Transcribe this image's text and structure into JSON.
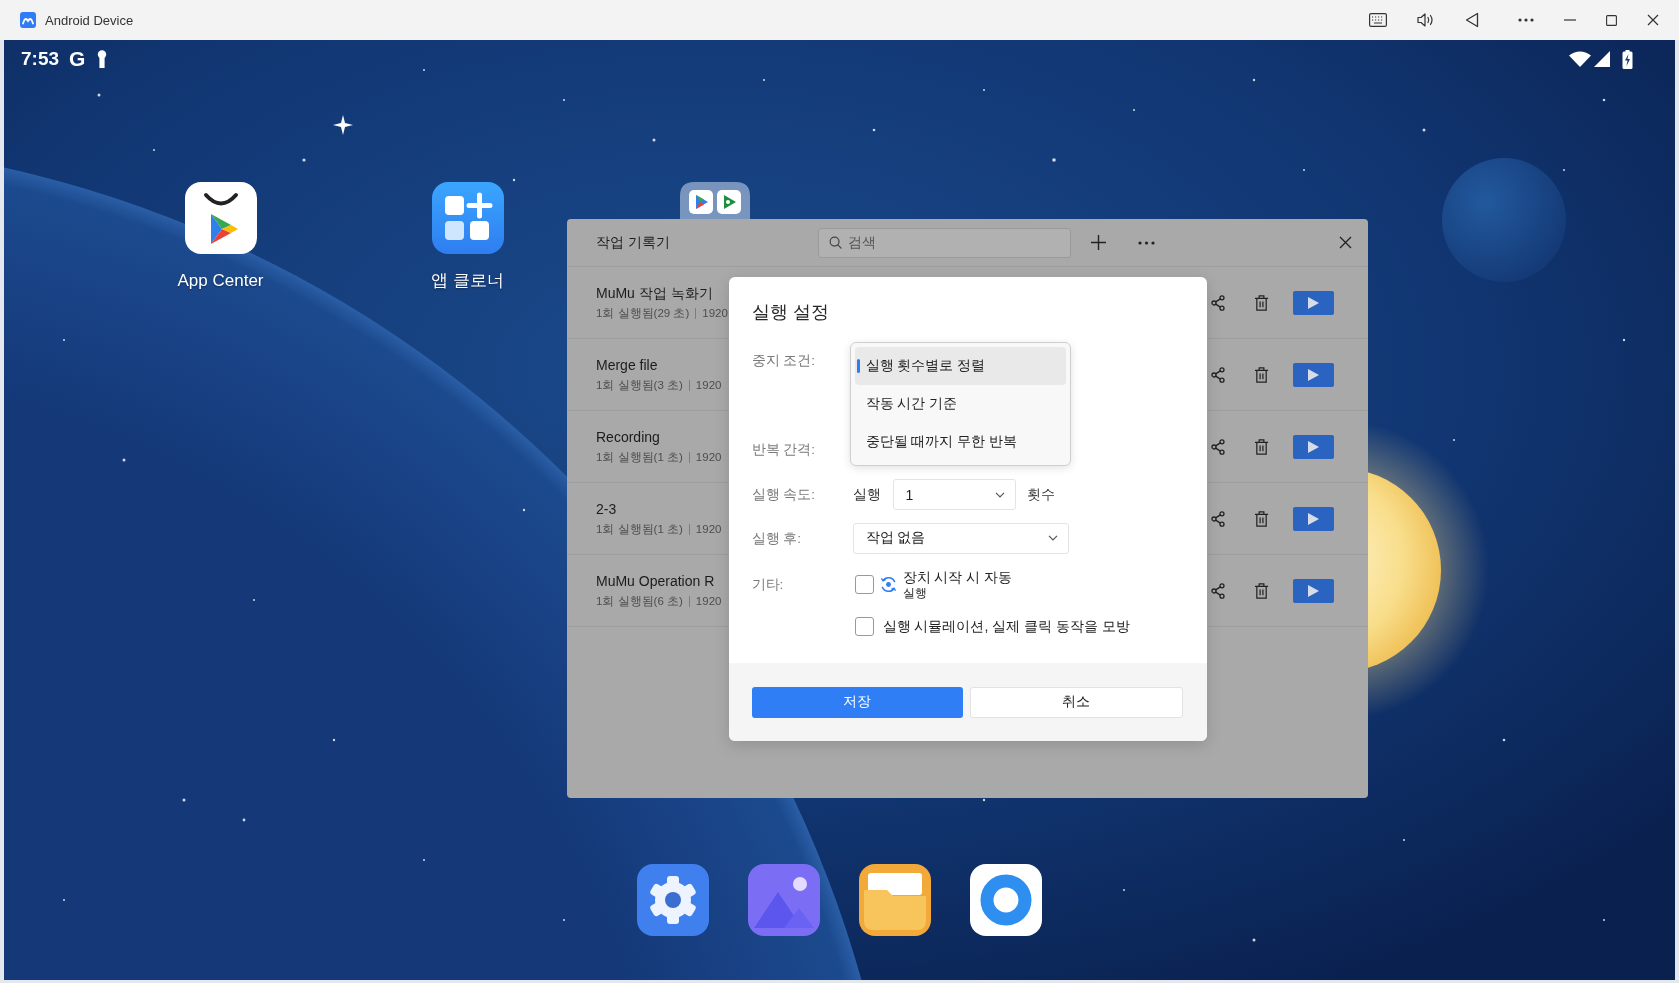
{
  "window": {
    "title": "Android Device"
  },
  "status_bar": {
    "time": "7:53",
    "notification": "G"
  },
  "desktop": {
    "apps": [
      {
        "kind": "store",
        "label": "App Center"
      },
      {
        "kind": "cloner",
        "label": "앱 클로너"
      },
      {
        "kind": "folder"
      }
    ]
  },
  "recorder": {
    "title": "작업 기록기",
    "search": {
      "placeholder": "검색"
    },
    "records": [
      {
        "name": "MuMu 작업 녹화기",
        "runs": "1회 실행됨(29 초)",
        "date": "1920"
      },
      {
        "name": "Merge file",
        "runs": "1회 실행됨(3 초)",
        "date": "1920"
      },
      {
        "name": "Recording",
        "runs": "1회 실행됨(1 초)",
        "date": "1920"
      },
      {
        "name": "2-3",
        "runs": "1회 실행됨(1 초)",
        "date": "1920"
      },
      {
        "name": "MuMu Operation R",
        "runs": "1회 실행됨(6 초)",
        "date": "1920"
      }
    ]
  },
  "dialog": {
    "title": "실행 설정",
    "stop_condition": {
      "label": "중지 조건:",
      "options": [
        {
          "label": "실행 횟수별로 정렬",
          "selected": true
        },
        {
          "label": "작동 시간 기준",
          "selected": false
        },
        {
          "label": "중단될 때까지 무한 반복",
          "selected": false
        }
      ]
    },
    "repeat_interval": {
      "label": "반복 간격:"
    },
    "run_speed": {
      "label": "실행 속도:",
      "prefix": "실행",
      "value": "1",
      "suffix": "횟수"
    },
    "after_run": {
      "label": "실행 후:",
      "value": "작업 없음"
    },
    "other": {
      "label": "기타:",
      "options": [
        {
          "kind": "autostart",
          "lines": [
            "장치 시작 시 자동",
            "실행"
          ],
          "checked": false
        },
        {
          "kind": "plain",
          "lines": [
            "실행 시뮬레이션, 실제 클릭 동작을 모방"
          ],
          "checked": false
        }
      ]
    },
    "buttons": [
      {
        "kind": "primary",
        "label": "저장"
      },
      {
        "kind": "secondary",
        "label": "취소"
      }
    ]
  }
}
